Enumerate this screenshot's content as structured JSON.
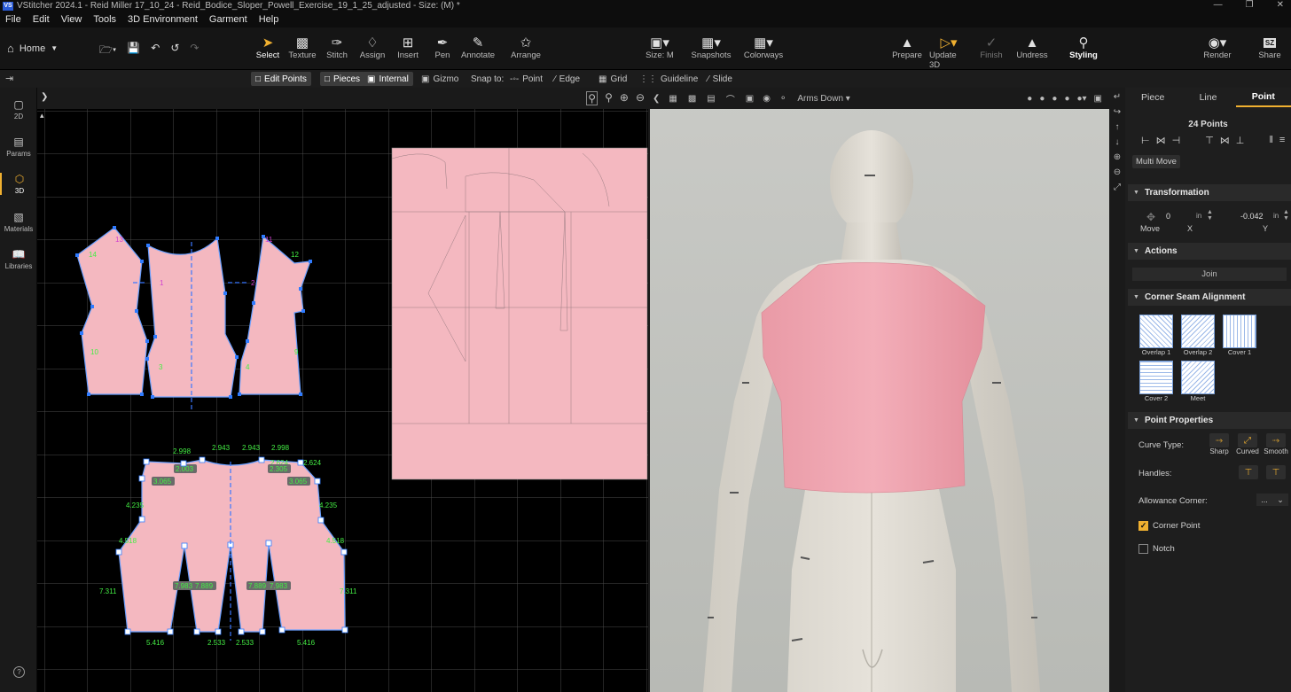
{
  "title": {
    "app_icon": "VS",
    "text": "VStitcher 2024.1 - Reid Miller 17_10_24 - Reid_Bodice_Sloper_Powell_Exercise_19_1_25_adjusted - Size: (M) *"
  },
  "menu": [
    "File",
    "Edit",
    "View",
    "Tools",
    "3D Environment",
    "Garment",
    "Help"
  ],
  "toolbar": {
    "home": "Home",
    "tools": [
      {
        "label": "Select",
        "icon": "cursor-icon"
      },
      {
        "label": "Texture",
        "icon": "texture-icon"
      },
      {
        "label": "Stitch",
        "icon": "stitch-icon"
      },
      {
        "label": "Assign",
        "icon": "bucket-icon"
      },
      {
        "label": "Insert",
        "icon": "plus-square-icon"
      },
      {
        "label": "Pen",
        "icon": "pen-icon"
      },
      {
        "label": "Annotate",
        "icon": "annotate-icon"
      },
      {
        "label": "Arrange",
        "icon": "arrange-icon"
      }
    ],
    "mid": [
      {
        "label": "Size: M",
        "icon": "size-icon"
      },
      {
        "label": "Snapshots",
        "icon": "snapshot-icon"
      },
      {
        "label": "Colorways",
        "icon": "colorways-icon"
      }
    ],
    "right": [
      {
        "label": "Prepare",
        "icon": "shirt-icon"
      },
      {
        "label": "Update 3D",
        "icon": "play-icon"
      },
      {
        "label": "Finish",
        "icon": "check-icon"
      },
      {
        "label": "Undress",
        "icon": "undress-icon"
      },
      {
        "label": "Styling",
        "icon": "styling-icon"
      },
      {
        "label": "Render",
        "icon": "camera-icon"
      },
      {
        "label": "Share",
        "icon": "share-icon",
        "badge": "SZ"
      }
    ]
  },
  "toolbar2": {
    "edit_points": "Edit Points",
    "pieces": "Pieces",
    "internal": "Internal",
    "gizmo": "Gizmo",
    "snap_to": "Snap to:",
    "point": "Point",
    "edge": "Edge",
    "grid": "Grid",
    "guideline": "Guideline",
    "slide": "Slide"
  },
  "sidebar": [
    {
      "label": "2D",
      "icon": "2d-icon"
    },
    {
      "label": "Params",
      "icon": "params-icon"
    },
    {
      "label": "3D",
      "icon": "cube-icon",
      "active": true
    },
    {
      "label": "Materials",
      "icon": "materials-icon"
    },
    {
      "label": "Libraries",
      "icon": "book-icon"
    }
  ],
  "view3d": {
    "pose": "Arms Down"
  },
  "pattern": {
    "upper_numbers": [
      "13",
      "14",
      "1",
      "2",
      "11",
      "12",
      "10",
      "3",
      "4",
      "9"
    ],
    "lower_measures": [
      "2.998",
      "2.943",
      "2.943",
      "2.998",
      "2.624",
      "2.624",
      "4.235",
      "4.235",
      "4.518",
      "4.518",
      "7.311",
      "7.311",
      "5.416",
      "2.533",
      "2.533",
      "5.416"
    ],
    "lower_badges": [
      "3.065",
      "2.003",
      "2.305",
      "3.065",
      "7.983",
      "7.889",
      "7.889",
      "7.983"
    ]
  },
  "panel": {
    "tabs": [
      "Piece",
      "Line",
      "Point"
    ],
    "active_tab": "Point",
    "points_count": "24 Points",
    "multi_move": "Multi Move",
    "transformation": {
      "title": "Transformation",
      "move": "Move",
      "x_value": "0",
      "y_value": "-0.042",
      "unit": "in",
      "x": "X",
      "y": "Y"
    },
    "actions": {
      "title": "Actions",
      "join": "Join"
    },
    "corner_seam": {
      "title": "Corner Seam Alignment",
      "items": [
        "Overlap 1",
        "Overlap 2",
        "Cover 1",
        "Cover 2",
        "Meet"
      ]
    },
    "point_props": {
      "title": "Point Properties",
      "curve_type": "Curve Type:",
      "sharp": "Sharp",
      "curved": "Curved",
      "smooth": "Smooth",
      "handles": "Handles:",
      "allowance_corner": "Allowance Corner:",
      "allowance_value": "...",
      "corner_point": "Corner Point",
      "corner_point_checked": true,
      "notch": "Notch",
      "notch_checked": false
    }
  },
  "colors": {
    "accent": "#f0b030",
    "fabric": "#f4b8c0",
    "measure": "#44ee44",
    "grid": "#4a4a4a"
  }
}
